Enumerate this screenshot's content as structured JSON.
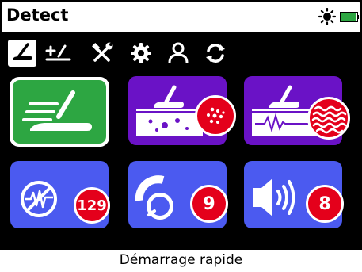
{
  "header": {
    "title": "Detect",
    "icons": [
      "sun-icon",
      "battery-icon"
    ]
  },
  "tabs": [
    {
      "name": "detect",
      "icon": "detector-icon",
      "selected": true
    },
    {
      "name": "ground",
      "icon": "ground-balance-icon",
      "selected": false
    },
    {
      "name": "tools",
      "icon": "tools-icon",
      "selected": false
    },
    {
      "name": "settings",
      "icon": "gear-icon",
      "selected": false
    },
    {
      "name": "user",
      "icon": "user-icon",
      "selected": false
    },
    {
      "name": "sync",
      "icon": "sync-icon",
      "selected": false
    }
  ],
  "tiles": [
    {
      "name": "quick-start",
      "icon": "quick-start-detector-icon",
      "color": "#2da642",
      "selected": true
    },
    {
      "name": "discrimination",
      "icon": "discrimination-icon",
      "color": "#6a12c6"
    },
    {
      "name": "ground-type",
      "icon": "ground-type-icon",
      "color": "#6a12c6"
    },
    {
      "name": "noise-cancel",
      "icon": "noise-cancel-icon",
      "color": "#4b5af0",
      "value": "129"
    },
    {
      "name": "sensitivity",
      "icon": "sensitivity-dial-icon",
      "color": "#4b5af0",
      "value": "9"
    },
    {
      "name": "volume",
      "icon": "speaker-icon",
      "color": "#4b5af0",
      "value": "8"
    }
  ],
  "footer": {
    "label": "Démarrage rapide"
  },
  "colors": {
    "badge": "#e4001b",
    "battery": "#2da642"
  }
}
